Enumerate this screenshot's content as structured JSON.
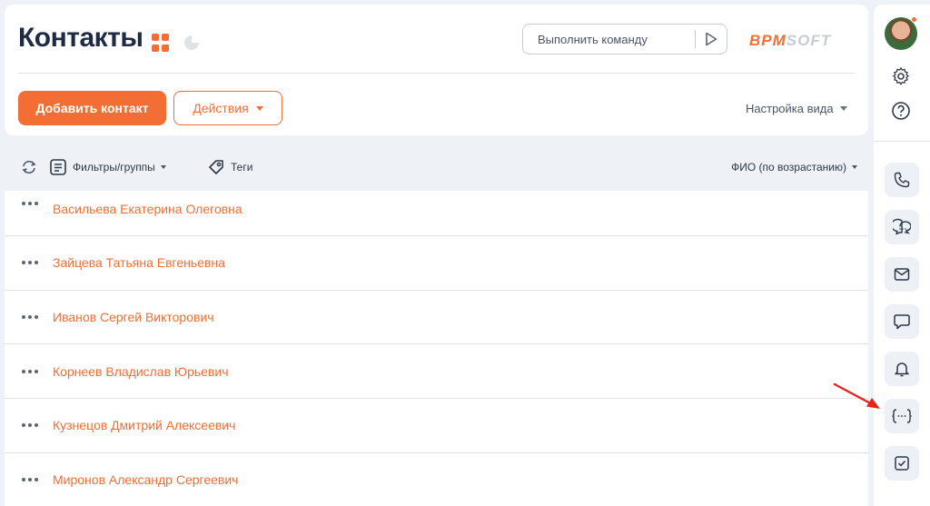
{
  "header": {
    "title": "Контакты",
    "command_placeholder": "Выполнить команду",
    "logo_part1": "BPM",
    "logo_part2": "SOFT",
    "add_button": "Добавить контакт",
    "actions_button": "Действия",
    "view_settings": "Настройка вида"
  },
  "filter_bar": {
    "filters_label": "Фильтры/группы",
    "tags_label": "Теги",
    "sort_label": "ФИО (по возрастанию)"
  },
  "contacts": [
    "Васильева Екатерина Олеговна",
    "Зайцева Татьяна Евгеньевна",
    "Иванов Сергей Викторович",
    "Корнеев Владислав Юрьевич",
    "Кузнецов Дмитрий Алексеевич",
    "Миронов Александр Сергеевич"
  ],
  "colors": {
    "accent": "#f26e34",
    "text_dark": "#1f2a44",
    "muted": "#c7ccd4",
    "arrow": "#e5251a"
  },
  "sidebar_icons": [
    "settings-icon",
    "help-icon",
    "phone-icon",
    "chat-icon",
    "email-icon",
    "message-icon",
    "bell-icon",
    "process-icon",
    "task-icon"
  ]
}
